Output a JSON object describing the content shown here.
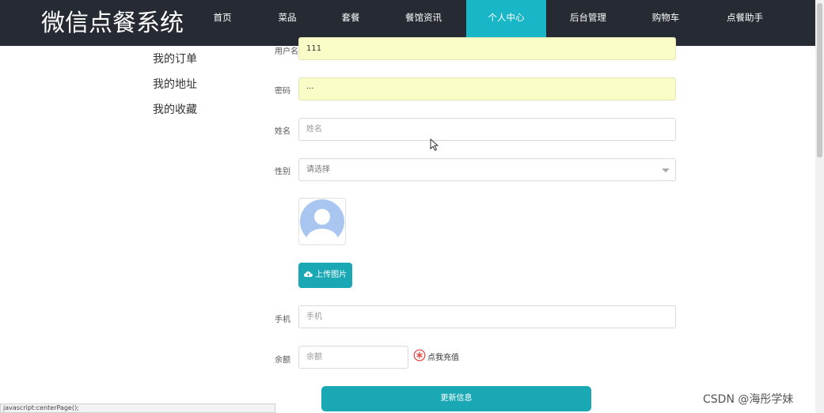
{
  "header": {
    "brand": "微信点餐系统",
    "nav": [
      {
        "label": "首页"
      },
      {
        "label": "菜品"
      },
      {
        "label": "套餐"
      },
      {
        "label": "餐馆资讯"
      },
      {
        "label": "个人中心",
        "active": true
      },
      {
        "label": "后台管理"
      },
      {
        "label": "购物车"
      },
      {
        "label": "点餐助手"
      }
    ]
  },
  "sidebar": {
    "items": [
      {
        "label": "我的订单"
      },
      {
        "label": "我的地址"
      },
      {
        "label": "我的收藏"
      }
    ]
  },
  "form": {
    "username": {
      "label": "用户名",
      "value": "111"
    },
    "password": {
      "label": "密码",
      "value": "···"
    },
    "name": {
      "label": "姓名",
      "placeholder": "姓名"
    },
    "gender": {
      "label": "性别",
      "selected": "请选择"
    },
    "avatar_icon": "user-avatar-icon",
    "upload_label": "上传图片",
    "phone": {
      "label": "手机",
      "placeholder": "手机"
    },
    "balance": {
      "label": "余额",
      "placeholder": "余额"
    },
    "recharge_label": "点我充值",
    "submit_label": "更新信息"
  },
  "status_bar": "javascript:centerPage();",
  "watermark": "CSDN @海彤学妹",
  "colors": {
    "header_bg": "#262b33",
    "accent": "#19b6c7",
    "button": "#1aa8b5",
    "autofill": "#fafcc8"
  }
}
